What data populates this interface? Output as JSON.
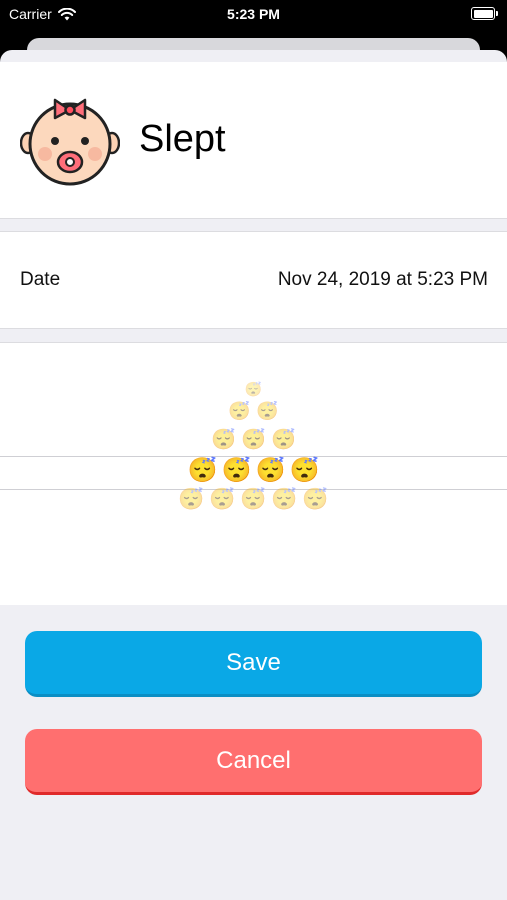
{
  "status_bar": {
    "carrier": "Carrier",
    "time": "5:23 PM",
    "icons": [
      "wifi-icon",
      "battery-icon"
    ]
  },
  "header": {
    "title": "Slept",
    "avatar_icon": "baby-face-icon"
  },
  "date_row": {
    "label": "Date",
    "value": "Nov 24, 2019 at 5:23 PM"
  },
  "picker": {
    "selected": "😴😴😴😴",
    "rows": [
      "😴",
      "😴😴",
      "😴😴😴",
      "😴😴😴😴",
      "😴😴😴😴😴"
    ]
  },
  "buttons": {
    "save_label": "Save",
    "cancel_label": "Cancel"
  },
  "colors": {
    "save": "#0aa8e6",
    "cancel": "#ff6f6f",
    "background": "#efeff4"
  }
}
